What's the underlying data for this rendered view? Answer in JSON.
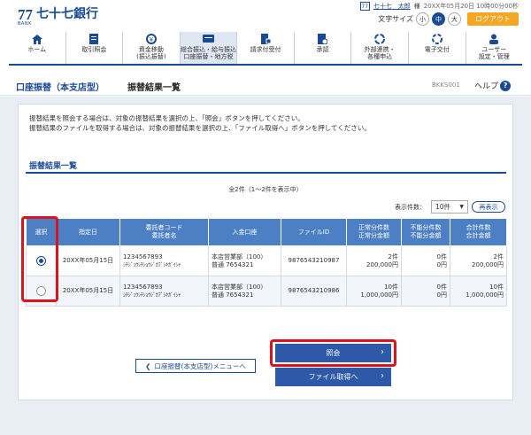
{
  "header": {
    "logo_mark": "77",
    "logo_bank": "BANK",
    "logo_name": "七十七銀行",
    "user_name": "七十七　太郎",
    "user_suffix": "様",
    "datetime": "20XX年05月20日 10時00分00秒",
    "font_size_label": "文字サイズ",
    "font_small": "小",
    "font_medium": "中",
    "font_large": "大",
    "logout_label": "ログアウト"
  },
  "nav": [
    {
      "label": "ホーム",
      "icon": "home-icon"
    },
    {
      "label": "取引照会",
      "icon": "document-icon"
    },
    {
      "label": "資金移動\n(振込振替)",
      "icon": "transfer-icon"
    },
    {
      "label": "総合振込・給与振込\n口座振替・地方税",
      "icon": "payroll-icon",
      "active": true
    },
    {
      "label": "請求付受付",
      "icon": "request-icon"
    },
    {
      "label": "承認",
      "icon": "approval-icon"
    },
    {
      "label": "外部連携・\n各種申込",
      "icon": "link-icon"
    },
    {
      "label": "電子交付",
      "icon": "electronic-icon"
    },
    {
      "label": "ユーザー\n設定・管理",
      "icon": "user-settings-icon"
    }
  ],
  "title": {
    "crumb1": "口座振替（本支店型）",
    "crumb2": "振替結果一覧",
    "screen_id": "BKKS001",
    "help": "ヘルプ"
  },
  "info": {
    "line1": "振替結果を照会する場合は、対象の振替結果を選択の上、「照会」ボタンを押してください。",
    "line2": "振替結果のファイルを取得する場合は、対象の振替結果を選択の上、「ファイル取得へ」ボタンを押してください。"
  },
  "section": {
    "title": "振替結果一覧",
    "count": "全2件（1～2件を表示中）",
    "page_size_label": "表示件数：",
    "page_size_value": "10件",
    "redisplay": "再表示"
  },
  "table": {
    "headers": [
      "選択",
      "指定日",
      "委託者コード\n委託者名",
      "入金口座",
      "ファイルID",
      "正常分件数\n正常分金額",
      "不能分件数\n不能分金額",
      "合計件数\n合計金額"
    ],
    "rows": [
      {
        "selected": true,
        "date": "20XX年05月15日",
        "code": "1234567893",
        "name": "ｼﾁｼﾞｭｳｼﾁｼｮｳｼﾞｶﾌﾞｼｷｶﾞｲｼｬ",
        "branch": "本店営業部（100）",
        "account": "普通 7654321",
        "file_id": "9876543210987",
        "ok_count": "2件",
        "ok_amount": "200,000円",
        "ng_count": "0件",
        "ng_amount": "0円",
        "total_count": "2件",
        "total_amount": "200,000円"
      },
      {
        "selected": false,
        "date": "20XX年05月15日",
        "code": "1234567893",
        "name": "ｼﾁｼﾞｭｳｼﾁｼｮｳｼﾞｶﾌﾞｼｷｶﾞｲｼｬ",
        "branch": "本店営業部（100）",
        "account": "普通 7654321",
        "file_id": "9876543210986",
        "ok_count": "10件",
        "ok_amount": "1,000,000円",
        "ng_count": "0件",
        "ng_amount": "0円",
        "total_count": "10件",
        "total_amount": "1,000,000円"
      }
    ]
  },
  "buttons": {
    "back": "口座振替(本支店型)メニューへ",
    "inquiry": "照会",
    "file": "ファイル取得へ"
  },
  "colors": {
    "brand": "#1a4a94",
    "table_header": "#4d7fc4",
    "button": "#2e59a8",
    "highlight": "#d9141e",
    "logout": "#f5a623"
  }
}
